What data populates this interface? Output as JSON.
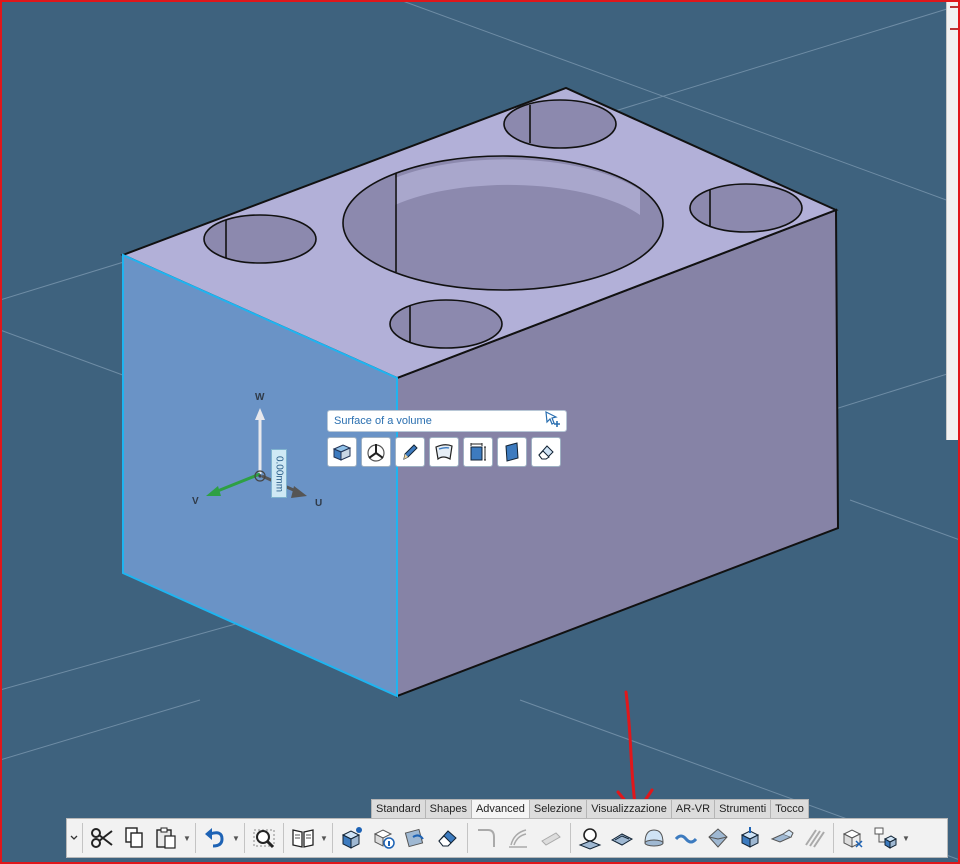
{
  "popup": {
    "title": "Surface of a volume"
  },
  "manipulator": {
    "axis_w": "W",
    "axis_v": "V",
    "axis_u": "U",
    "dimension": "0.00mm"
  },
  "ribbon": {
    "tabs": [
      {
        "label": "Standard"
      },
      {
        "label": "Shapes"
      },
      {
        "label": "Advanced",
        "active": true
      },
      {
        "label": "Selezione"
      },
      {
        "label": "Visualizzazione"
      },
      {
        "label": "AR-VR"
      },
      {
        "label": "Strumenti"
      },
      {
        "label": "Tocco"
      }
    ]
  },
  "colors": {
    "background": "#3e627e",
    "top_face": "#b2b0d8",
    "right_face": "#8683a6",
    "selected_face": "#6a93c6",
    "selection_edge": "#1fb4f0",
    "annotation_arrow": "#e0171b"
  }
}
